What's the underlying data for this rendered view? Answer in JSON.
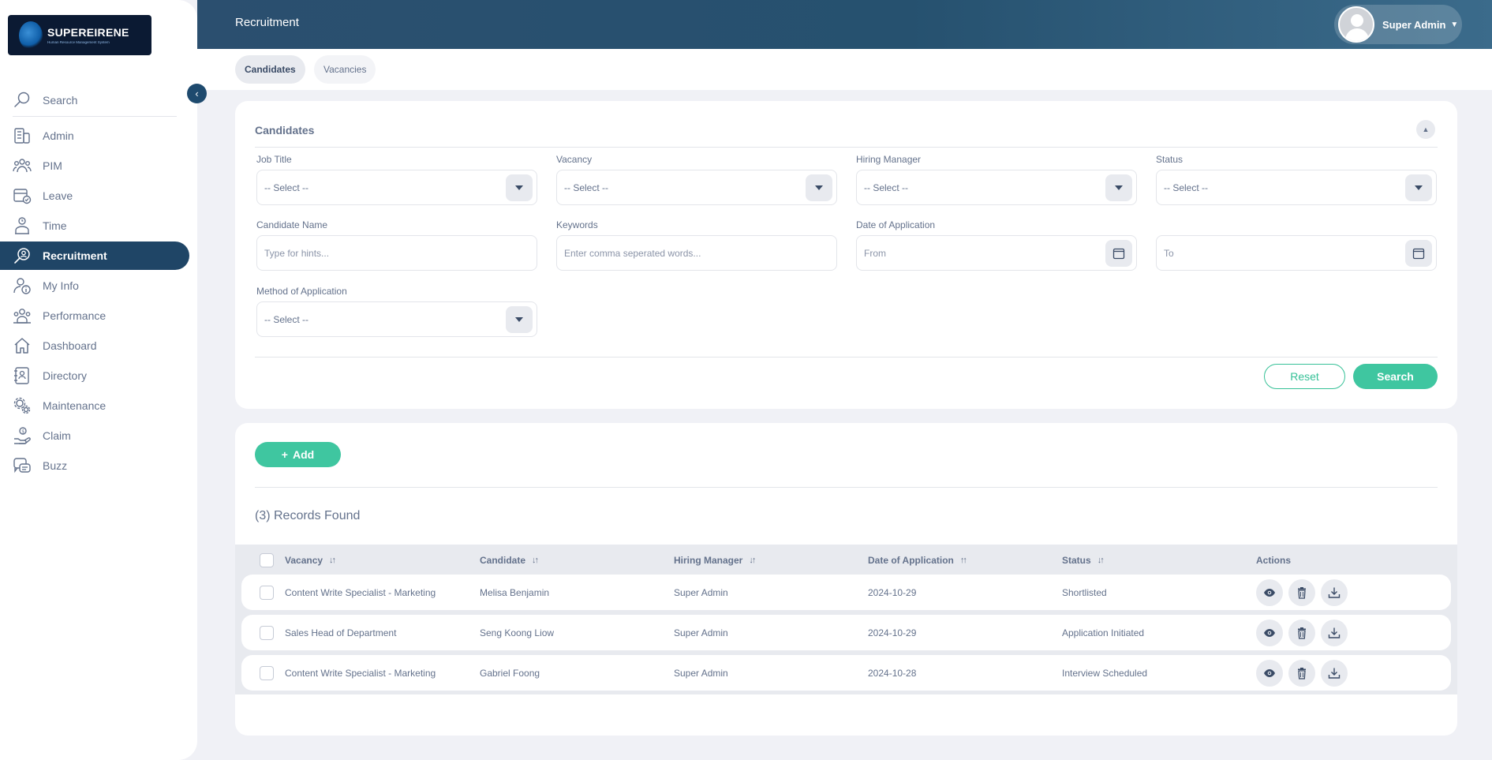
{
  "brand": {
    "name": "SUPEREIRENE",
    "subtitle": "Human Resource Management System"
  },
  "header": {
    "title": "Recruitment",
    "user": "Super Admin"
  },
  "sidebar": {
    "search_label": "Search",
    "items": [
      {
        "label": "Admin",
        "icon": "admin-icon"
      },
      {
        "label": "PIM",
        "icon": "pim-icon"
      },
      {
        "label": "Leave",
        "icon": "leave-icon"
      },
      {
        "label": "Time",
        "icon": "time-icon"
      },
      {
        "label": "Recruitment",
        "icon": "recruitment-icon",
        "active": true
      },
      {
        "label": "My Info",
        "icon": "myinfo-icon"
      },
      {
        "label": "Performance",
        "icon": "performance-icon"
      },
      {
        "label": "Dashboard",
        "icon": "dashboard-icon"
      },
      {
        "label": "Directory",
        "icon": "directory-icon"
      },
      {
        "label": "Maintenance",
        "icon": "maintenance-icon"
      },
      {
        "label": "Claim",
        "icon": "claim-icon"
      },
      {
        "label": "Buzz",
        "icon": "buzz-icon"
      }
    ]
  },
  "tabs": [
    {
      "label": "Candidates",
      "active": true
    },
    {
      "label": "Vacancies",
      "active": false
    }
  ],
  "filters": {
    "title": "Candidates",
    "job_title": {
      "label": "Job Title",
      "value": "-- Select --"
    },
    "vacancy": {
      "label": "Vacancy",
      "value": "-- Select --"
    },
    "hiring_manager": {
      "label": "Hiring Manager",
      "value": "-- Select --"
    },
    "status": {
      "label": "Status",
      "value": "-- Select --"
    },
    "candidate_name": {
      "label": "Candidate Name",
      "placeholder": "Type for hints..."
    },
    "keywords": {
      "label": "Keywords",
      "placeholder": "Enter comma seperated words..."
    },
    "date_of_application": {
      "label": "Date of Application",
      "from_placeholder": "From",
      "to_placeholder": "To"
    },
    "method": {
      "label": "Method of Application",
      "value": "-- Select --"
    },
    "reset_label": "Reset",
    "search_label": "Search"
  },
  "records": {
    "add_label": "Add",
    "found_text": "(3) Records Found",
    "columns": {
      "vacancy": "Vacancy",
      "candidate": "Candidate",
      "hiring_manager": "Hiring Manager",
      "date": "Date of Application",
      "status": "Status",
      "actions": "Actions"
    },
    "rows": [
      {
        "vacancy": "Content Write Specialist - Marketing",
        "candidate": "Melisa Benjamin",
        "hiring_manager": "Super Admin",
        "date": "2024-10-29",
        "status": "Shortlisted"
      },
      {
        "vacancy": "Sales Head of Department",
        "candidate": "Seng Koong Liow",
        "hiring_manager": "Super Admin",
        "date": "2024-10-29",
        "status": "Application Initiated"
      },
      {
        "vacancy": "Content Write Specialist - Marketing",
        "candidate": "Gabriel Foong",
        "hiring_manager": "Super Admin",
        "date": "2024-10-28",
        "status": "Interview Scheduled"
      }
    ]
  },
  "colors": {
    "accent": "#3fc6a0",
    "nav_active": "#1f4566",
    "topbar": "#2b4f6f"
  }
}
